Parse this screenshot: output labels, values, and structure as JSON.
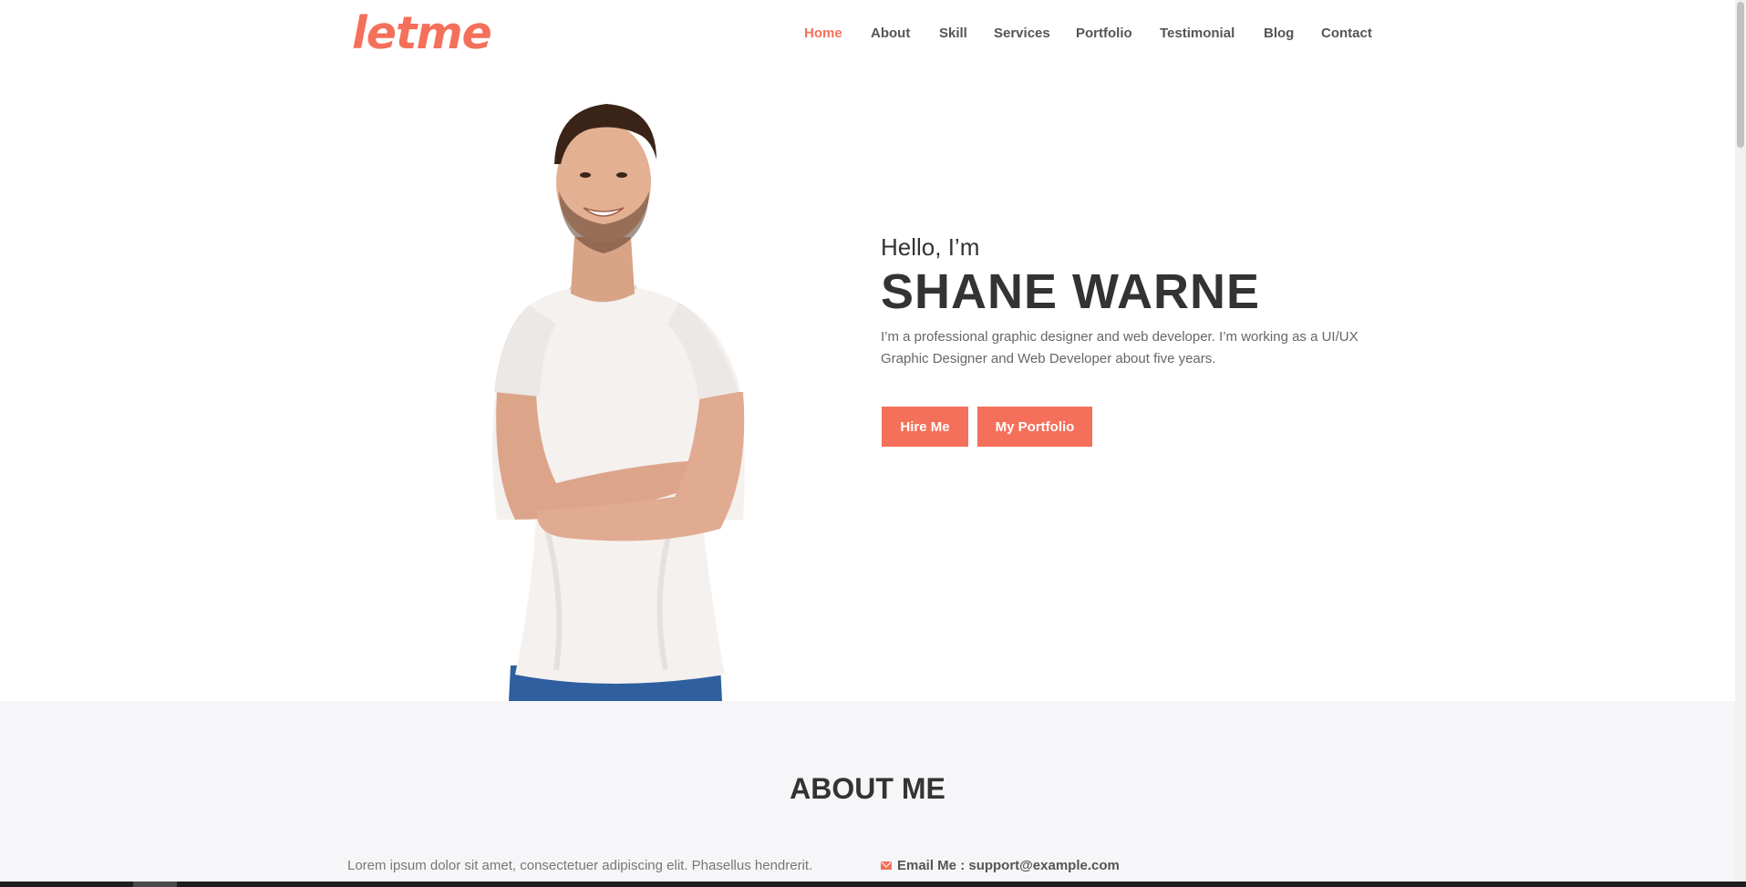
{
  "brand": {
    "logo": "letme",
    "accent_color": "#f4705b"
  },
  "nav": {
    "items": [
      {
        "label": "Home",
        "active": true
      },
      {
        "label": "About"
      },
      {
        "label": "Skill"
      },
      {
        "label": "Services"
      },
      {
        "label": "Portfolio"
      },
      {
        "label": "Testimonial"
      },
      {
        "label": "Blog"
      },
      {
        "label": "Contact"
      }
    ]
  },
  "hero": {
    "greeting": "Hello, I’m",
    "name": "SHANE WARNE",
    "intro": "I’m a professional graphic designer and web developer. I’m working as a UI/UX Graphic Designer and Web Developer about five years.",
    "hire_label": "Hire Me",
    "portfolio_label": "My Portfolio"
  },
  "about": {
    "title": "ABOUT ME",
    "text": "Lorem ipsum dolor sit amet, consectetuer adipiscing elit. Phasellus hendrerit.",
    "email_label": "Email Me : support@example.com",
    "email_icon": "envelope-icon"
  }
}
